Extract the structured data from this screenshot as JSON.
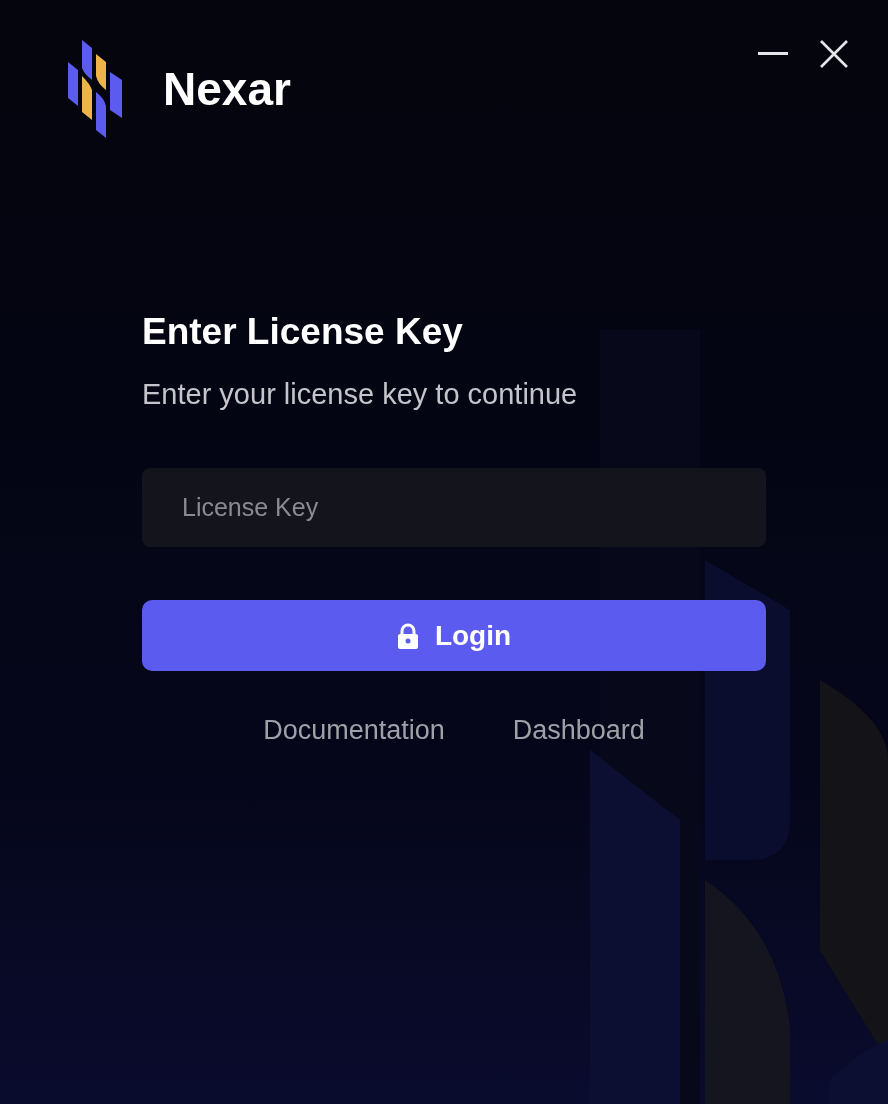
{
  "app": {
    "name": "Nexar"
  },
  "heading": "Enter License Key",
  "subtitle": "Enter your license key to continue",
  "license_field": {
    "placeholder": "License Key"
  },
  "login_button": {
    "label": "Login"
  },
  "links": [
    {
      "label": "Documentation"
    },
    {
      "label": "Dashboard"
    }
  ]
}
